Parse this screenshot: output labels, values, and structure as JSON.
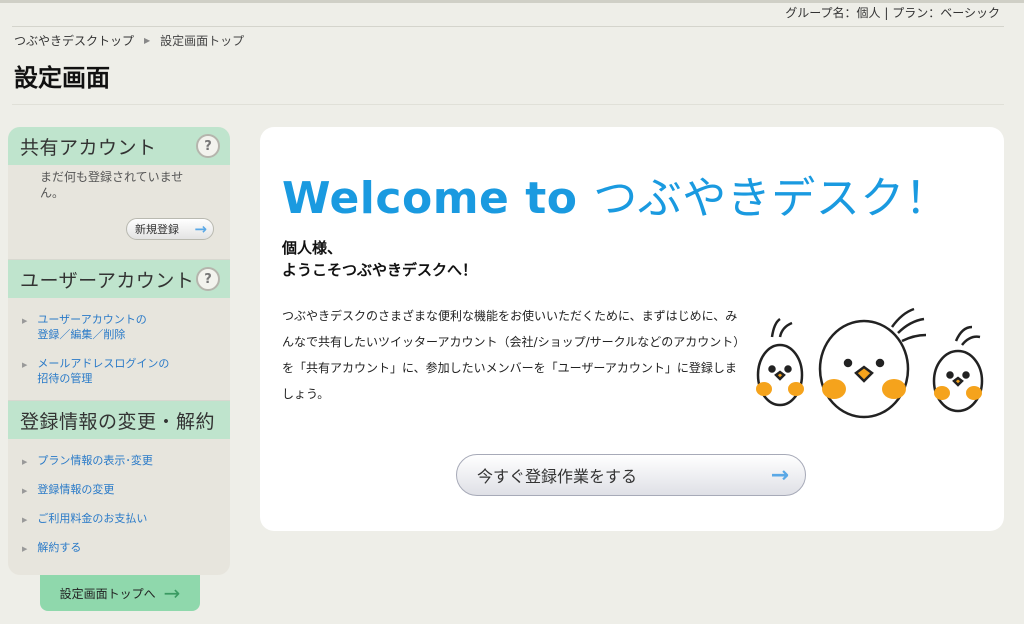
{
  "top_bar": {
    "group_plan": "グループ名：個人 | プラン：ベーシック"
  },
  "breadcrumb": {
    "home": "つぶやきデスクトップ",
    "current": "設定画面トップ"
  },
  "page_title": "設定画面",
  "sidebar": {
    "shared_accounts": {
      "heading": "共有アカウント",
      "empty_text": "まだ何も登録されていません。",
      "register_button": "新規登録"
    },
    "user_accounts": {
      "heading": "ユーザーアカウント",
      "links": [
        "ユーザーアカウントの登録／編集／削除",
        "メールアドレスログインの招待の管理"
      ]
    },
    "registration": {
      "heading": "登録情報の変更・解約",
      "links": [
        "プラン情報の表示･変更",
        "登録情報の変更",
        "ご利用料金のお支払い",
        "解約する"
      ]
    },
    "settings_top_button": "設定画面トップへ"
  },
  "main": {
    "welcome_en": "Welcome to ",
    "welcome_jp": "つぶやきデスク！",
    "greeting_line1": "個人様、",
    "greeting_line2": "ようこそつぶやきデスクへ！",
    "intro": "つぶやきデスクのさまざまな便利な機能をお使いいただくために、まずはじめに、みんなで共有したいツイッターアカウント（会社/ショップ/サークルなどのアカウント）を「共有アカウント」に、参加したいメンバーを「ユーザーアカウント」に登録しましょう。",
    "cta_button": "今すぐ登録作業をする"
  },
  "icons": {
    "help": "help-icon",
    "arrow": "arrow-right-icon",
    "bullet": "triangle-bullet-icon"
  },
  "colors": {
    "accent_blue": "#1a9ae0",
    "link_blue": "#2a7ac8",
    "section_green": "#bfe4cd",
    "button_green": "#8fd8ac",
    "bird_orange": "#f5a31c"
  }
}
